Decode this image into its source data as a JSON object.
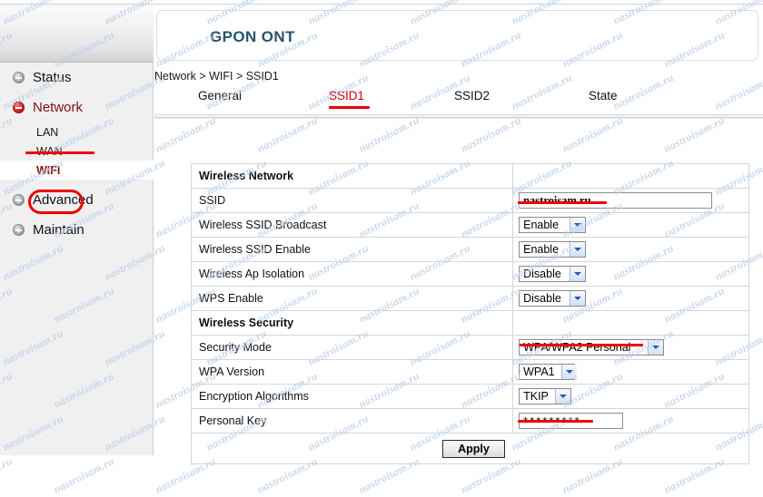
{
  "header": {
    "title": "GPON ONT",
    "breadcrumb": "Network > WIFI > SSID1"
  },
  "sidebar": {
    "groups": [
      {
        "label": "Status",
        "icon": "plus-circle-icon",
        "expanded": false
      },
      {
        "label": "Network",
        "icon": "minus-circle-icon",
        "expanded": true
      },
      {
        "label": "Advanced",
        "icon": "plus-circle-icon",
        "expanded": false
      },
      {
        "label": "Maintain",
        "icon": "plus-circle-icon",
        "expanded": false
      }
    ],
    "network_children": [
      {
        "label": "LAN",
        "active": false
      },
      {
        "label": "WAN",
        "active": false
      },
      {
        "label": "WIFI",
        "active": true
      }
    ]
  },
  "tabs": [
    {
      "label": "General",
      "active": false
    },
    {
      "label": "SSID1",
      "active": true
    },
    {
      "label": "SSID2",
      "active": false
    },
    {
      "label": "State",
      "active": false
    }
  ],
  "form": {
    "sections": [
      {
        "title": "Wireless Network",
        "rows": [
          {
            "label": "SSID",
            "control": "text",
            "value": "nastroisam.ru"
          },
          {
            "label": "Wireless SSID Broadcast",
            "control": "select",
            "value": "Enable"
          },
          {
            "label": "Wireless SSID Enable",
            "control": "select",
            "value": "Enable"
          },
          {
            "label": "Wireless Ap Isolation",
            "control": "select",
            "value": "Disable"
          },
          {
            "label": "WPS Enable",
            "control": "select",
            "value": "Disable"
          }
        ]
      },
      {
        "title": "Wireless Security",
        "rows": [
          {
            "label": "Security Mode",
            "control": "select",
            "value": "WPA/WPA2 Personal"
          },
          {
            "label": "WPA Version",
            "control": "select",
            "value": "WPA1"
          },
          {
            "label": "Encryption Algorithms",
            "control": "select",
            "value": "TKIP"
          },
          {
            "label": "Personal Key",
            "control": "password",
            "value": "*********"
          }
        ]
      }
    ],
    "apply_label": "Apply"
  },
  "annotations": {
    "color": "#ee0000",
    "items": [
      "underline-network",
      "ring-wifi",
      "underline-ssid1-tab",
      "underline-ssid-value",
      "underline-security-mode",
      "underline-personal-key"
    ]
  },
  "watermark": {
    "text": "nastroisam.ru",
    "color": "#b9cfea"
  }
}
